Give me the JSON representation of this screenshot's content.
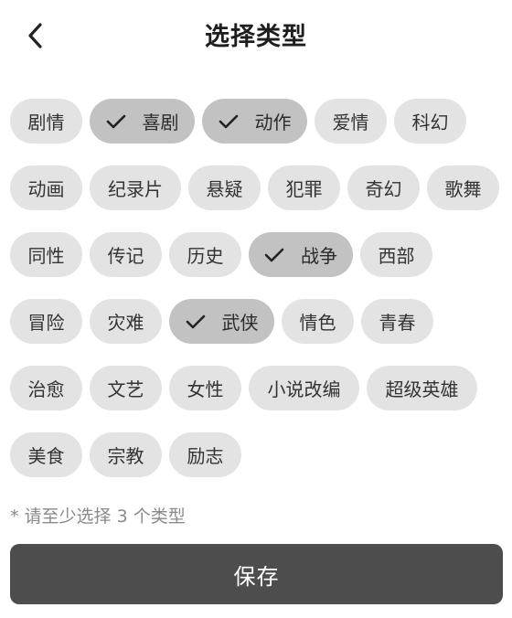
{
  "header": {
    "title": "选择类型",
    "back_icon": "chevron-left-icon"
  },
  "tags": [
    {
      "label": "剧情",
      "selected": false
    },
    {
      "label": "喜剧",
      "selected": true
    },
    {
      "label": "动作",
      "selected": true
    },
    {
      "label": "爱情",
      "selected": false
    },
    {
      "label": "科幻",
      "selected": false
    },
    {
      "label": "动画",
      "selected": false
    },
    {
      "label": "纪录片",
      "selected": false
    },
    {
      "label": "悬疑",
      "selected": false
    },
    {
      "label": "犯罪",
      "selected": false
    },
    {
      "label": "奇幻",
      "selected": false
    },
    {
      "label": "歌舞",
      "selected": false
    },
    {
      "label": "同性",
      "selected": false
    },
    {
      "label": "传记",
      "selected": false
    },
    {
      "label": "历史",
      "selected": false
    },
    {
      "label": "战争",
      "selected": true
    },
    {
      "label": "西部",
      "selected": false
    },
    {
      "label": "冒险",
      "selected": false
    },
    {
      "label": "灾难",
      "selected": false
    },
    {
      "label": "武侠",
      "selected": true
    },
    {
      "label": "情色",
      "selected": false
    },
    {
      "label": "青春",
      "selected": false
    },
    {
      "label": "治愈",
      "selected": false
    },
    {
      "label": "文艺",
      "selected": false
    },
    {
      "label": "女性",
      "selected": false
    },
    {
      "label": "小说改编",
      "selected": false
    },
    {
      "label": "超级英雄",
      "selected": false
    },
    {
      "label": "美食",
      "selected": false
    },
    {
      "label": "宗教",
      "selected": false
    },
    {
      "label": "励志",
      "selected": false
    }
  ],
  "hint": "* 请至少选择 3 个类型",
  "save_label": "保存",
  "colors": {
    "tag_bg": "#e3e3e3",
    "tag_selected_bg": "#c2c2c2",
    "button_bg": "#4d4d4d",
    "hint_text": "#8a8a8a"
  }
}
